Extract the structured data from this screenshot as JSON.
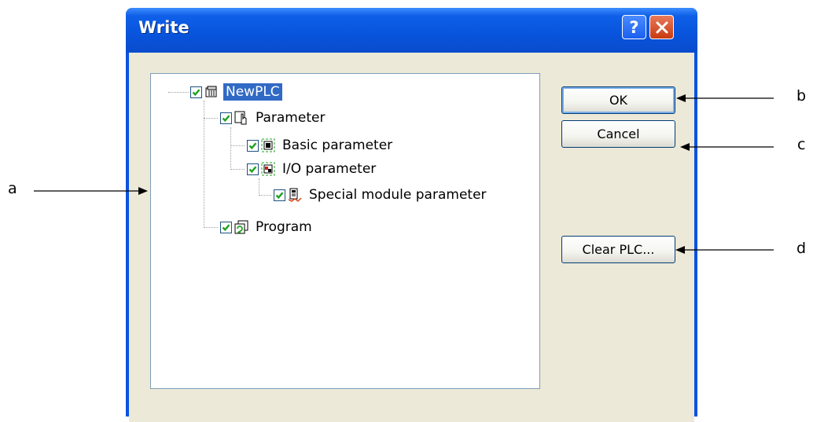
{
  "window": {
    "title": "Write",
    "help_label": "?"
  },
  "tree": {
    "items": [
      {
        "label": "NewPLC",
        "checked": true,
        "icon": "plc-icon"
      },
      {
        "label": "Parameter",
        "checked": true,
        "icon": "parameter-icon"
      },
      {
        "label": "Basic parameter",
        "checked": true,
        "icon": "basic-parameter-icon"
      },
      {
        "label": "I/O parameter",
        "checked": true,
        "icon": "io-parameter-icon"
      },
      {
        "label": "Special module parameter",
        "checked": true,
        "icon": "special-module-icon"
      },
      {
        "label": "Program",
        "checked": true,
        "icon": "program-icon"
      }
    ]
  },
  "buttons": {
    "ok": "OK",
    "cancel": "Cancel",
    "clear_plc": "Clear PLC..."
  },
  "annotations": {
    "a": "a",
    "b": "b",
    "c": "c",
    "d": "d"
  },
  "colors": {
    "titlebar": "#0a53df",
    "selection": "#316ac5",
    "checkmark": "#21a121"
  }
}
